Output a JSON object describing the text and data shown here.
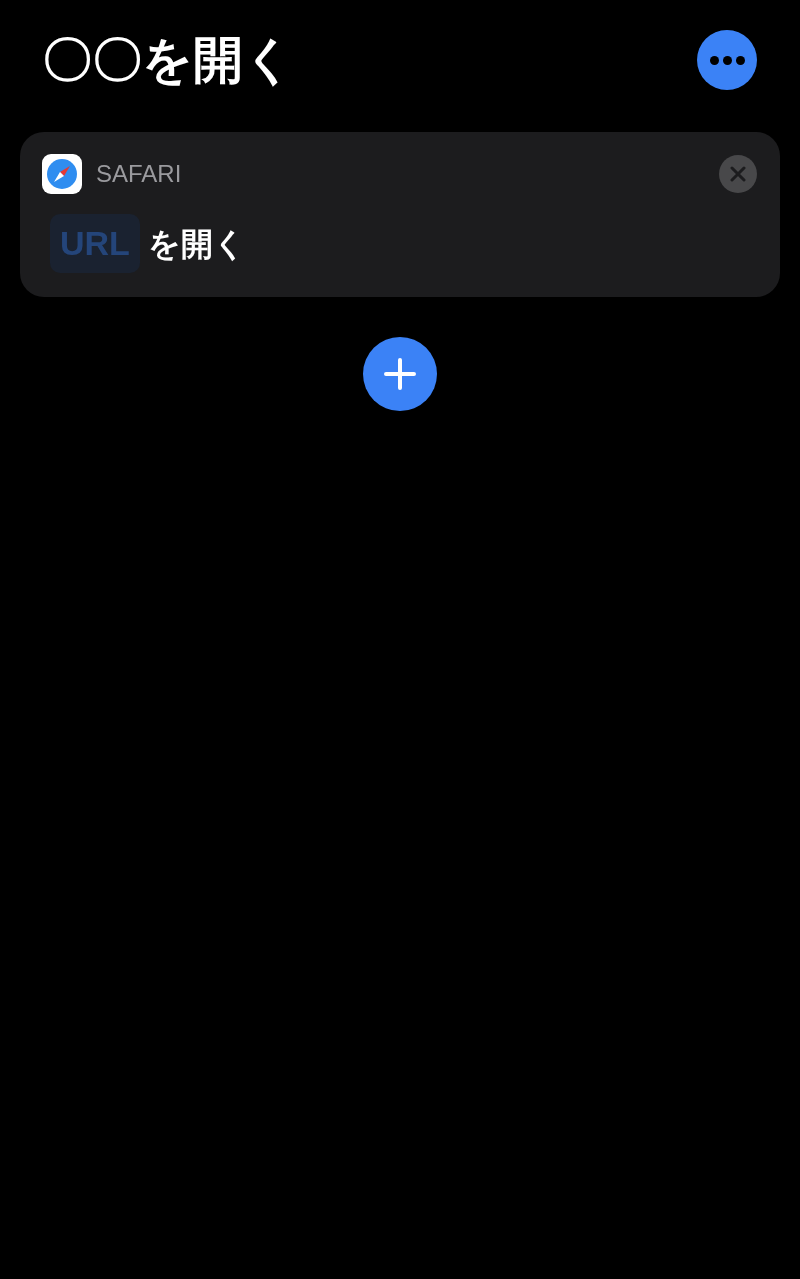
{
  "title": "〇〇を開く",
  "actions": [
    {
      "app": "SAFARI",
      "parameter": {
        "text": "URL",
        "filled": false
      },
      "text": "を開く"
    }
  ]
}
